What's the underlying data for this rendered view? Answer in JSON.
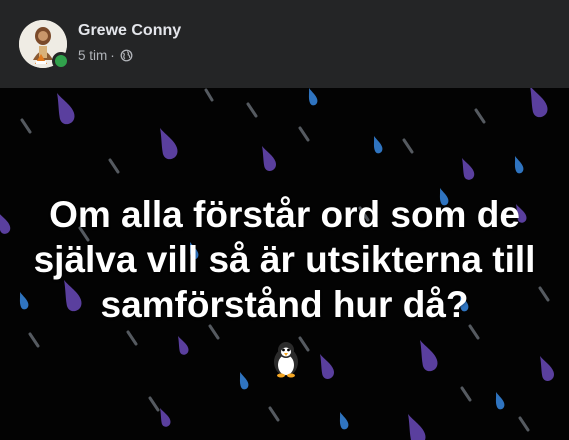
{
  "post": {
    "author": "Grewe Conny",
    "time": "5 tim",
    "separator": "·",
    "audience_icon": "globe-icon",
    "text_lines": [
      "Om alla förstår ord som de",
      "själva vill så är utsikterna till",
      "samförstånd hur då?"
    ],
    "emoji_icon": "penguin-emoji"
  },
  "colors": {
    "header_bg": "#242526",
    "name_text": "#e4e6eb",
    "meta_text": "#b0b3b8",
    "online_status": "#31a24c",
    "post_bg": "#030303",
    "post_text": "#ffffff",
    "drop_purple": "#5a3f9e",
    "drop_blue": "#2f74c0",
    "streak_gray": "#555a60"
  }
}
